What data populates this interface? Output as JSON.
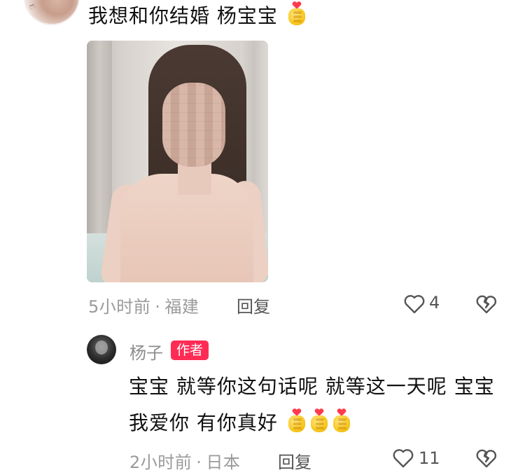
{
  "comment1": {
    "text": "我想和你结婚 杨宝宝",
    "emoji": "finger-heart",
    "time": "5小时前",
    "location": "福建",
    "reply_label": "回复",
    "likes": "4"
  },
  "comment2": {
    "username": "杨子",
    "badge": "作者",
    "text": "宝宝 就等你这句话呢 就等这一天呢 宝宝 我爱你 有你真好",
    "emoji_count": 3,
    "time": "2小时前",
    "location": "日本",
    "reply_label": "回复",
    "likes": "11"
  },
  "meta_separator": "·",
  "colors": {
    "badge": "#fe2c55",
    "meta_text": "#9a9a9a",
    "emoji_yellow": "#f8c820",
    "emoji_heart": "#ff3b4e"
  }
}
